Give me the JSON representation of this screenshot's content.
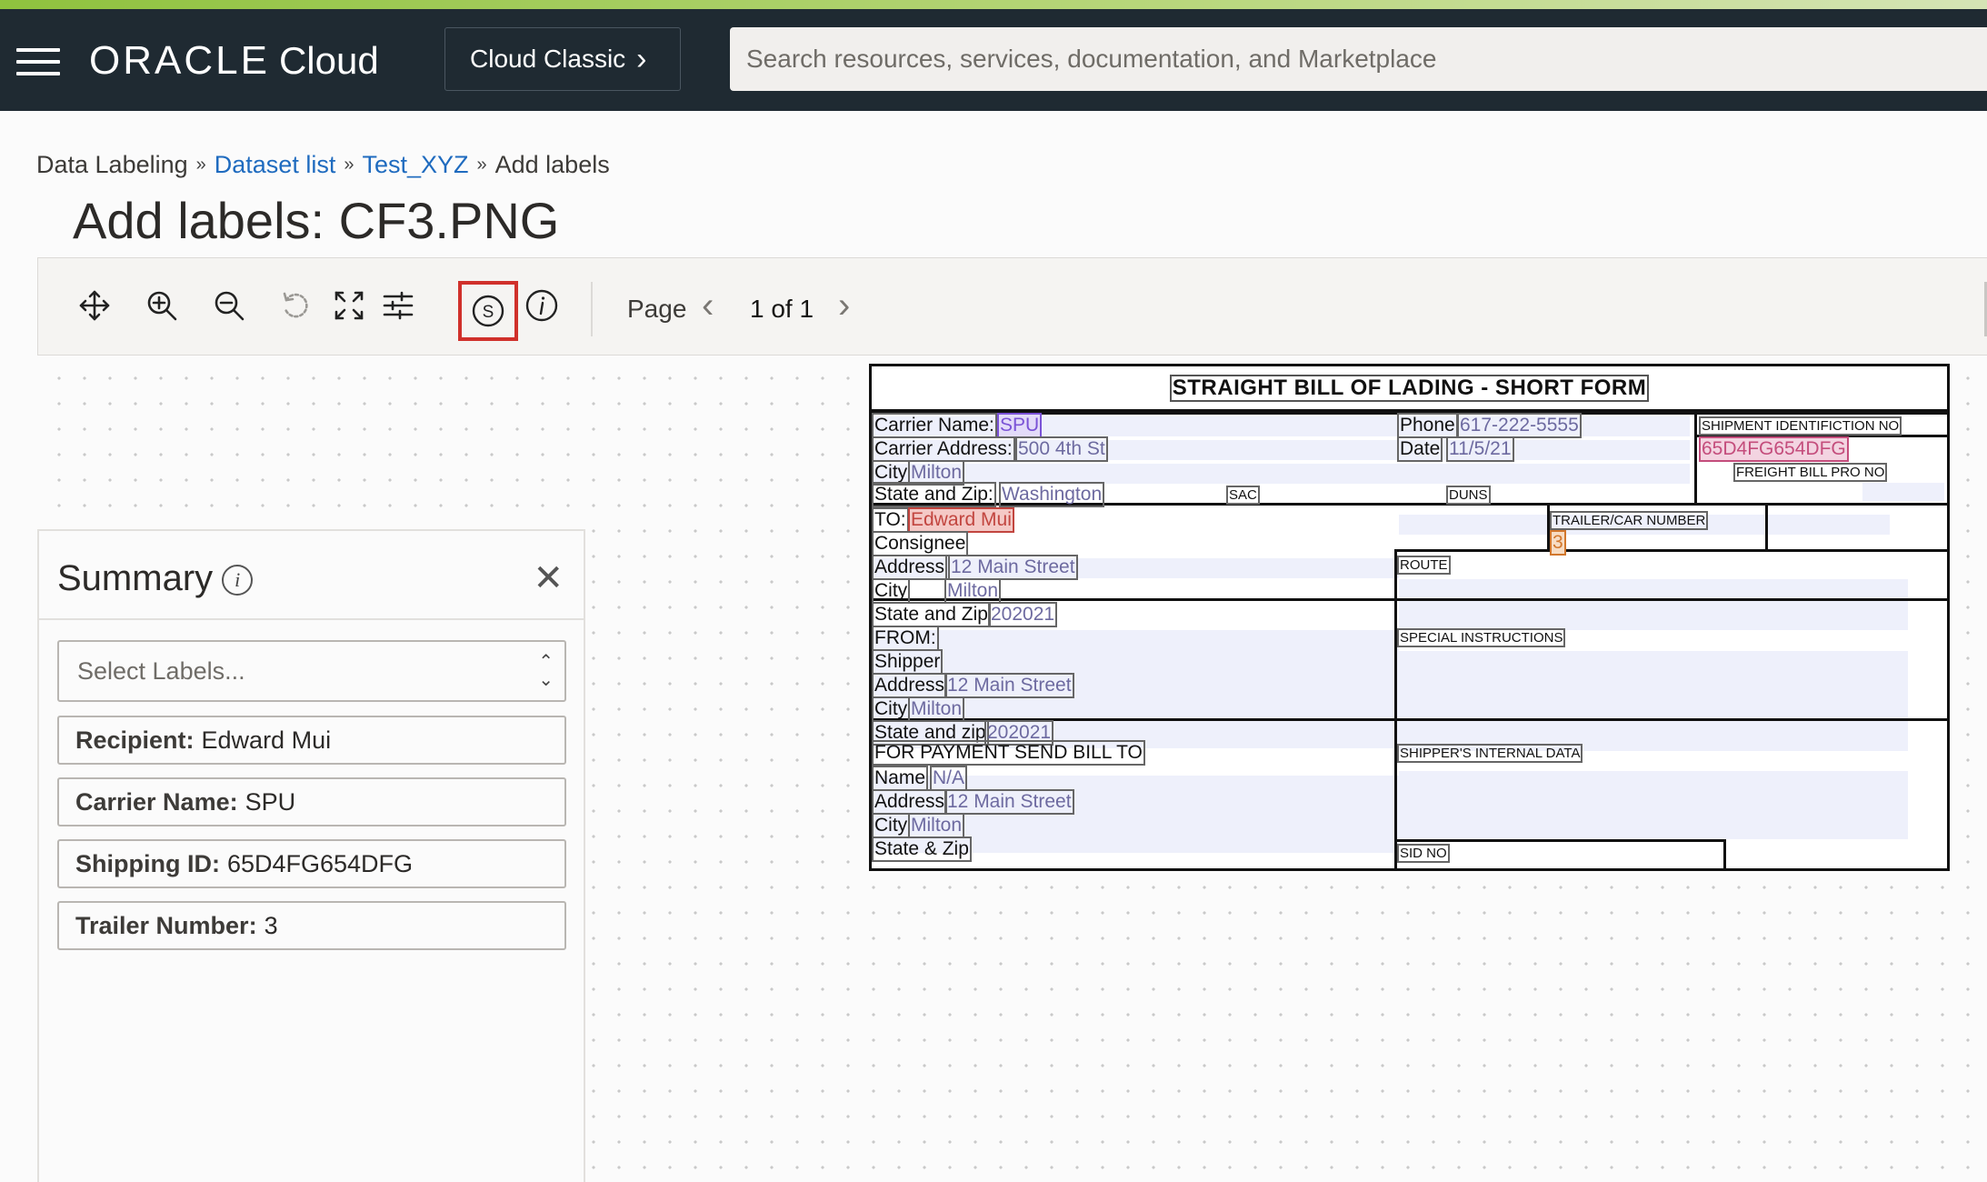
{
  "header": {
    "brand": "ORACLE",
    "product": "Cloud",
    "classic_button": "Cloud Classic",
    "search_placeholder": "Search resources, services, documentation, and Marketplace"
  },
  "breadcrumb": {
    "items": [
      "Data Labeling",
      "Dataset list",
      "Test_XYZ",
      "Add labels"
    ]
  },
  "page_title": "Add labels: CF3.PNG",
  "toolbar": {
    "tools": [
      "move-icon",
      "zoom-in-icon",
      "zoom-out-icon",
      "reset-icon",
      "fit-to-screen-icon",
      "adjustments-icon",
      "summary-icon",
      "info-icon"
    ],
    "summary_tool_letter": "S",
    "page_label": "Page",
    "page_indicator": "1 of 1"
  },
  "summary": {
    "title": "Summary",
    "select_placeholder": "Select Labels...",
    "labels": [
      {
        "key": "Recipient:",
        "value": "Edward Mui"
      },
      {
        "key": "Carrier Name:",
        "value": "SPU"
      },
      {
        "key": "Shipping ID:",
        "value": "65D4FG654DFG"
      },
      {
        "key": "Trailer Number:",
        "value": "3"
      }
    ]
  },
  "document": {
    "title": "STRAIGHT BILL OF LADING - SHORT FORM",
    "carrier_name_label": "Carrier Name:",
    "carrier_name": "SPU",
    "carrier_address_label": "Carrier Address:",
    "carrier_address": "500 4th St",
    "city_label": "City",
    "city": "Milton",
    "state_zip_label": "State and Zip:",
    "state": "Washington",
    "sac": "SAC",
    "duns": "DUNS",
    "phone_label": "Phone",
    "phone": "617-222-5555",
    "date_label": "Date",
    "date": "11/5/21",
    "shipment_id_label": "SHIPMENT IDENTIFICTION NO",
    "shipment_id": "65D4FG654DFG",
    "freight_label": "FREIGHT BILL PRO NO",
    "to_label": "TO:",
    "to_name": "Edward Mui",
    "consignee": "Consignee",
    "trailer_label": "TRAILER/CAR NUMBER",
    "trailer": "3",
    "address_label": "Address",
    "address": "12 Main Street",
    "state_and_zip_label": "State and Zip",
    "zip": "202021",
    "route": "ROUTE",
    "from_label": "FROM:",
    "shipper": "Shipper",
    "special_instructions": "SPECIAL INSTRUCTIONS",
    "state_and_zip_lower": "State and zip",
    "payment_label": "FOR PAYMENT SEND BILL TO",
    "shippers_internal": "SHIPPER'S INTERNAL DATA",
    "name_label": "Name",
    "name_value": "N/A",
    "state_amp_zip": "State & Zip",
    "sid_no": "SID NO"
  }
}
